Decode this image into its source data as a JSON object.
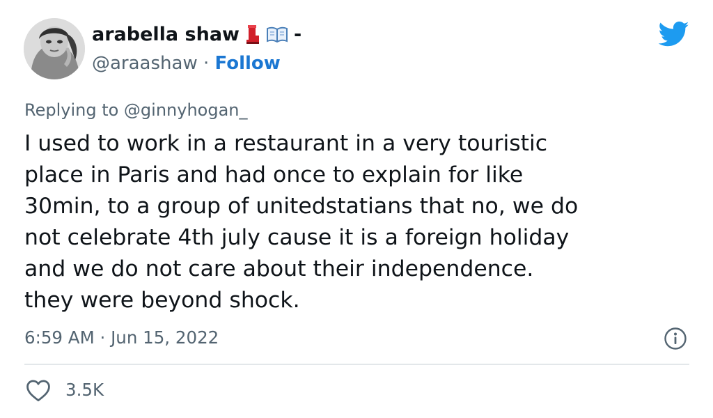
{
  "author": {
    "name": "arabella shaw",
    "emoji": [
      "boot-emoji",
      "open-book-emoji"
    ],
    "name_suffix": "-",
    "handle": "@araashaw",
    "separator": " · ",
    "follow_label": "Follow"
  },
  "tweet": {
    "replying_to": "Replying to @ginnyhogan_",
    "text_lines": [
      "I used to work in a restaurant in a very touristic",
      "place in Paris and had once to explain for like",
      "30min, to a group of unitedstatians that no, we do",
      "not celebrate 4th july cause it is a foreign holiday",
      "and we do not care about their independence.",
      "they were beyond shock."
    ],
    "timestamp": "6:59 AM · Jun 15, 2022"
  },
  "stats": {
    "likes": "3.5K"
  },
  "icons": {
    "brand": "twitter-bird-icon",
    "info": "info-icon",
    "like": "heart-icon"
  },
  "colors": {
    "accent": "#1d9bf0",
    "follow": "#1b77d2",
    "secondary_text": "#536471",
    "primary_text": "#0f1419",
    "divider": "#e3e7ea"
  }
}
